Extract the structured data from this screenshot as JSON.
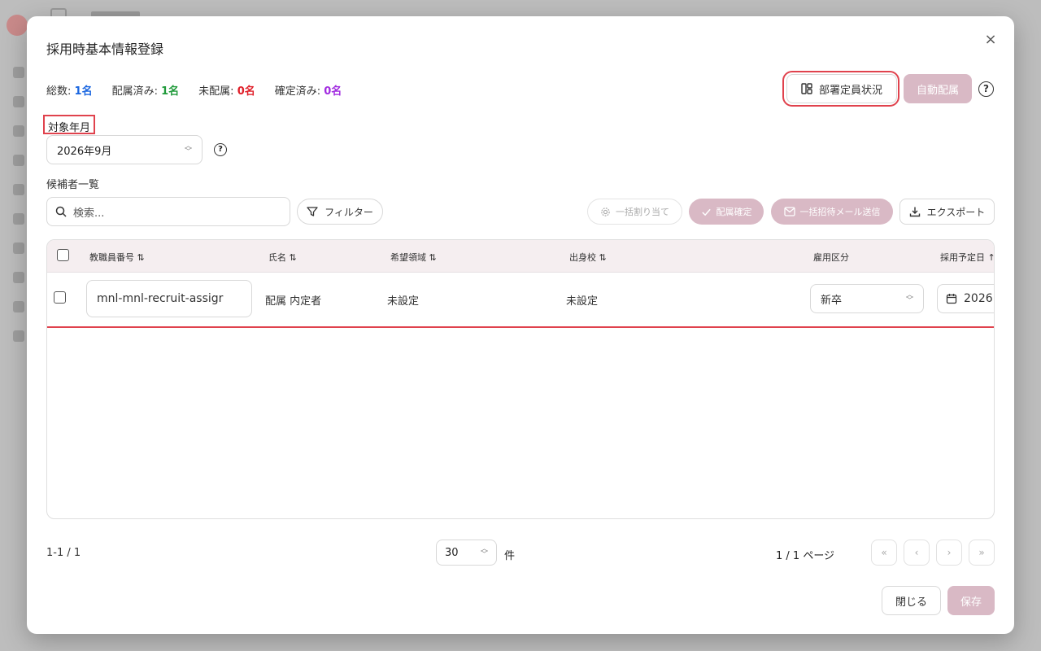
{
  "modal": {
    "title": "採用時基本情報登録",
    "close_glyph": "×"
  },
  "stats": {
    "total_label": "総数:",
    "total_value": "1名",
    "assigned_label": "配属済み:",
    "assigned_value": "1名",
    "unassigned_label": "未配属:",
    "unassigned_value": "0名",
    "confirmed_label": "確定済み:",
    "confirmed_value": "0名"
  },
  "toolbar": {
    "dept_status_label": "部署定員状況",
    "auto_assign_label": "自動配属",
    "help_glyph": "?"
  },
  "target_month": {
    "label": "対象年月",
    "value": "2026年9月",
    "help_glyph": "?"
  },
  "candidates": {
    "label": "候補者一覧",
    "search_placeholder": "検索...",
    "filter_label": "フィルター",
    "bulk_assign_label": "一括割り当て",
    "confirm_label": "配属確定",
    "bulk_mail_label": "一括招待メール送信",
    "export_label": "エクスポート"
  },
  "table": {
    "columns": [
      "教職員番号 ⇅",
      "氏名 ⇅",
      "希望領域 ⇅",
      "出身校 ⇅",
      "雇用区分",
      "採用予定日 ↑"
    ],
    "rows": [
      {
        "employee_id": "mnl-mnl-recruit-assigr",
        "name": "配属 内定者",
        "desired_area": "未設定",
        "school": "未設定",
        "employment_type": "新卒",
        "planned_date": "2026"
      }
    ]
  },
  "footer": {
    "range": "1-1 / 1",
    "per_page": "30",
    "per_page_unit": "件",
    "page_info": "1 / 1 ページ",
    "close_label": "閉じる",
    "save_label": "保存"
  },
  "colors": {
    "accent_disabled": "#d9b9c5",
    "highlight": "#e0424d",
    "total": "#1a66e0",
    "assigned": "#1f9a3a",
    "unassigned": "#e0202a",
    "confirmed": "#a12be0"
  }
}
